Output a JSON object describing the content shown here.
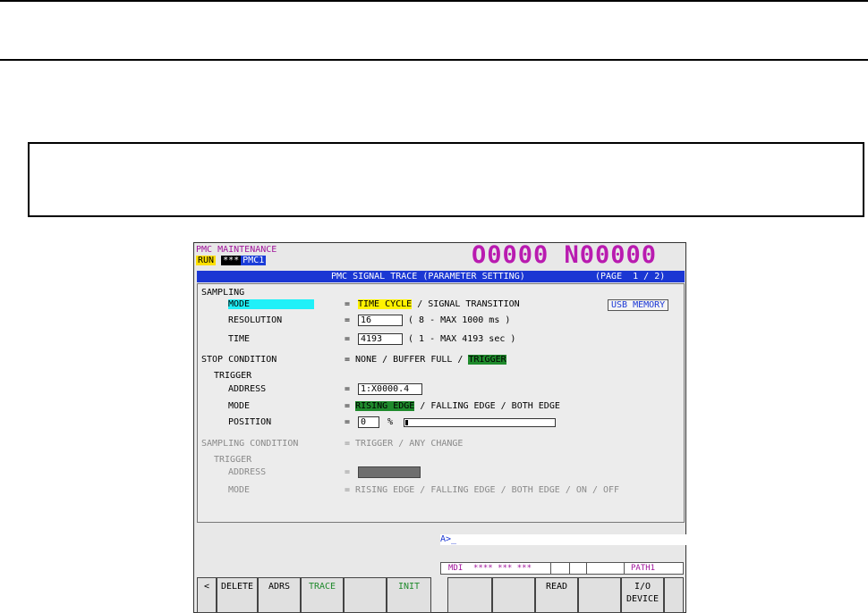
{
  "screen": {
    "header": {
      "app_title": "PMC MAINTENANCE",
      "run_badge": "RUN",
      "stars_badge": "***",
      "path_badge": "PMC1",
      "program_number": "O0000 N00000"
    },
    "title_bar": {
      "title": "PMC SIGNAL TRACE (PARAMETER SETTING)",
      "page": "(PAGE  1 / 2)"
    },
    "usb_button": "USB MEMORY",
    "sampling": {
      "section_label": "SAMPLING",
      "mode_label": "MODE",
      "mode_selected": "TIME CYCLE",
      "mode_other": "/ SIGNAL TRANSITION",
      "resolution_label": "RESOLUTION",
      "resolution_value": "16",
      "resolution_hint": "( 8 - MAX 1000 ms )",
      "time_label": "TIME",
      "time_value": "4193",
      "time_hint": "( 1 - MAX 4193 sec )"
    },
    "stop_condition": {
      "label": "STOP CONDITION",
      "options_prefix": "= NONE / BUFFER FULL /",
      "selected": "TRIGGER"
    },
    "trigger": {
      "label": "TRIGGER",
      "address_label": "ADDRESS",
      "address_value": "1:X0000.4",
      "mode_label": "MODE",
      "mode_selected": "RISING EDGE",
      "mode_other": "/ FALLING EDGE / BOTH EDGE",
      "position_label": "POSITION",
      "position_value": "0",
      "position_unit": "%",
      "position_fraction": 0.0
    },
    "sampling_condition": {
      "label": "SAMPLING CONDITION",
      "options": "= TRIGGER / ANY CHANGE",
      "trigger_label": "TRIGGER",
      "address_label": "ADDRESS",
      "mode_label": "MODE",
      "mode_options": "= RISING EDGE / FALLING EDGE / BOTH EDGE / ON / OFF"
    },
    "equals": "=",
    "prompt": "A>_",
    "status": {
      "mode": "MDI",
      "stars": "**** *** ***",
      "path": "PATH1"
    },
    "softkeys": [
      {
        "label": "<"
      },
      {
        "label": "DELETE"
      },
      {
        "label": "ADRS"
      },
      {
        "label": "TRACE"
      },
      {
        "label": ""
      },
      {
        "label": "INIT"
      },
      {
        "label": ""
      },
      {
        "label": ""
      },
      {
        "label": "READ"
      },
      {
        "label": ""
      },
      {
        "label": "I/O\nDEVICE"
      },
      {
        "label": ""
      }
    ]
  }
}
